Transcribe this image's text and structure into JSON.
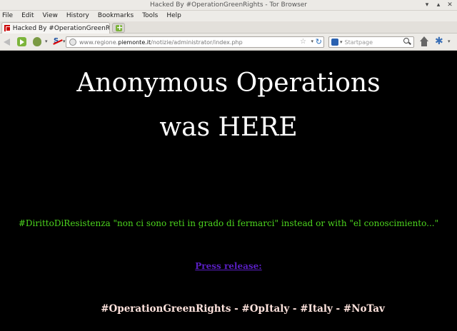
{
  "window": {
    "title": "Hacked By #OperationGreenRights - Tor Browser"
  },
  "menu": [
    "File",
    "Edit",
    "View",
    "History",
    "Bookmarks",
    "Tools",
    "Help"
  ],
  "tabs": [
    {
      "label": "Hacked By #OperationGreenRights"
    }
  ],
  "navbar": {
    "url_prefix": "www.regione.",
    "url_domain": "piemonte.it",
    "url_path": "/notizie/administrator/index.php",
    "search_placeholder": "Startpage"
  },
  "page": {
    "headline_line1": "Anonymous Operations",
    "headline_line2": "was HERE",
    "message": "#DirittoDiResistenza \"non ci sono reti in grado di fermarci\" instead or with \"el conoscimiento...\"",
    "link_text": "Press release:",
    "tags": "#OperationGreenRights - #OpItaly - #Italy - #NoTav"
  },
  "colors": {
    "page_background": "#000000",
    "headline": "#ffffff",
    "message": "#4cd41e",
    "link": "#5a1fc4",
    "tags": "#ffe3dd"
  },
  "icons": [
    "back-icon",
    "forward-icon",
    "tor-onion-icon",
    "noscript-icon",
    "globe-icon",
    "bookmark-star-icon",
    "reload-icon",
    "search-engine-icon",
    "search-icon",
    "home-icon",
    "addon-icon",
    "new-tab-icon",
    "minimize-icon",
    "maximize-icon",
    "close-icon"
  ]
}
